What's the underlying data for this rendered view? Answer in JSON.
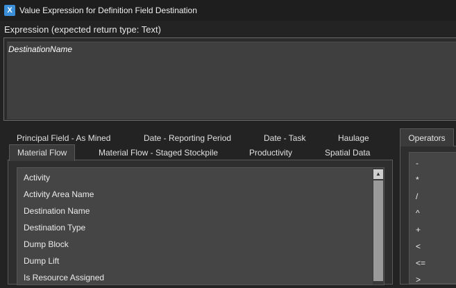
{
  "window": {
    "title": "Value Expression for Definition Field Destination",
    "icon": "expression-app-icon",
    "icon_glyph": "X"
  },
  "expression": {
    "label": "Expression (expected return type: Text)",
    "value": "DestinationName"
  },
  "tabs": {
    "row1": [
      {
        "label": "Principal Field - As Mined"
      },
      {
        "label": "Date - Reporting Period"
      },
      {
        "label": "Date - Task"
      },
      {
        "label": "Haulage"
      }
    ],
    "row2": [
      {
        "label": "Material Flow",
        "active": true
      },
      {
        "label": "Material Flow - Staged Stockpile"
      },
      {
        "label": "Productivity"
      },
      {
        "label": "Spatial Data"
      }
    ]
  },
  "fields": [
    "Activity",
    "Activity Area Name",
    "Destination Name",
    "Destination Type",
    "Dump Block",
    "Dump Lift",
    "Is Resource Assigned"
  ],
  "operators": {
    "tab_label": "Operators",
    "items": [
      "-",
      "*",
      "/",
      "^",
      "+",
      "<",
      "<=",
      ">"
    ]
  },
  "colors": {
    "background": "#232323",
    "editor": "#3f3f3f",
    "list": "#454545",
    "accent": "#3a8fd8"
  }
}
